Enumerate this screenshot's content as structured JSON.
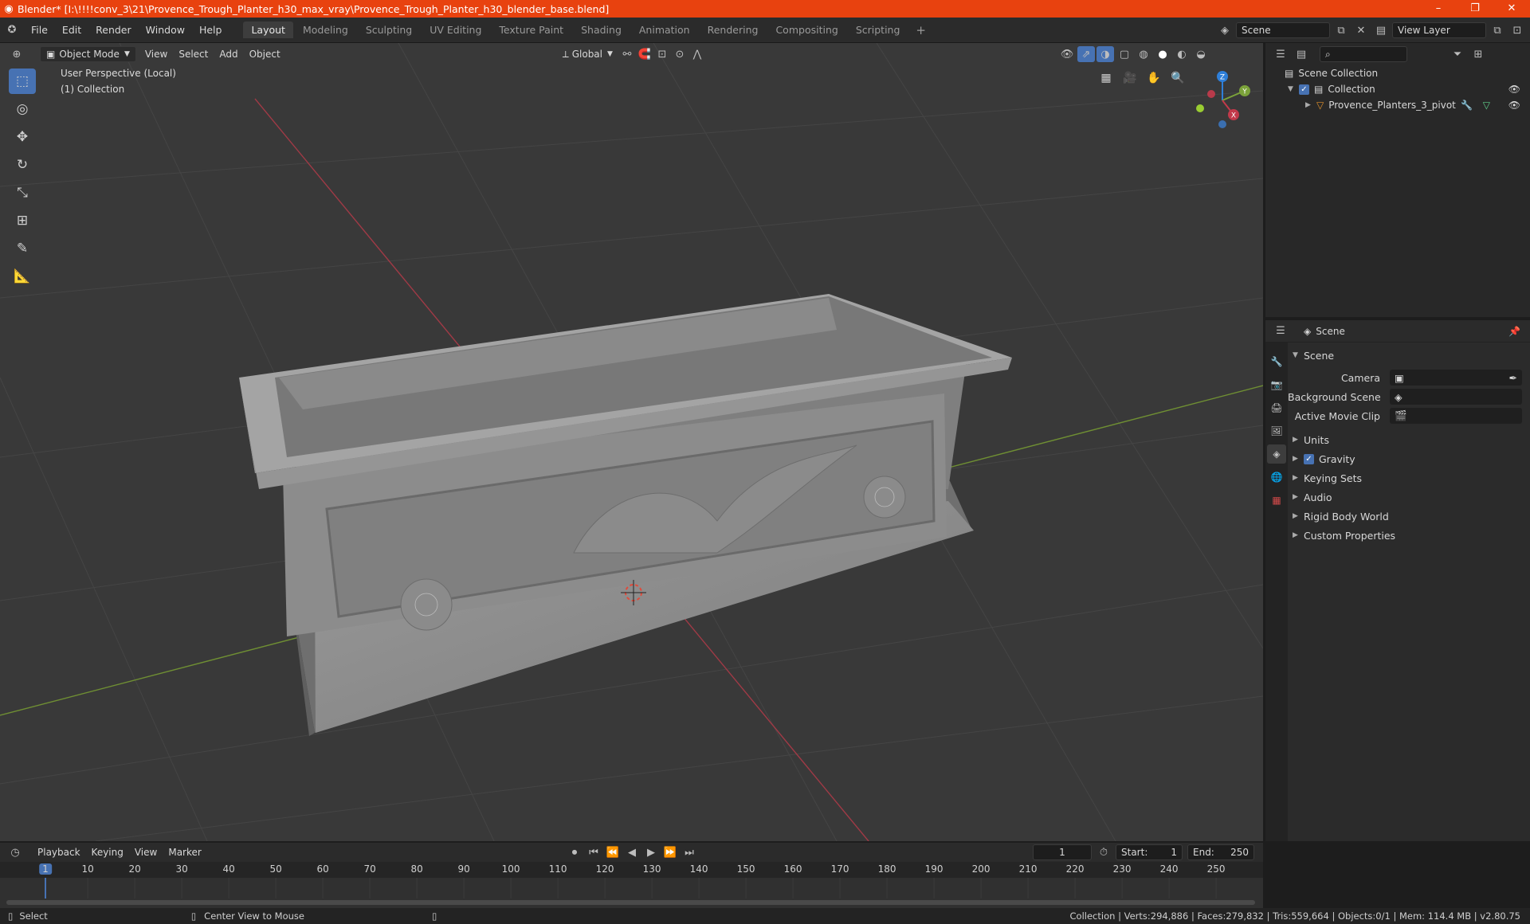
{
  "window": {
    "title": "Blender* [I:\\!!!!conv_3\\21\\Provence_Trough_Planter_h30_max_vray\\Provence_Trough_Planter_h30_blender_base.blend]",
    "controls": [
      "–",
      "❐",
      "✕"
    ]
  },
  "menu": [
    "File",
    "Edit",
    "Render",
    "Window",
    "Help"
  ],
  "workspaces": [
    {
      "label": "Layout",
      "active": true
    },
    {
      "label": "Modeling"
    },
    {
      "label": "Sculpting"
    },
    {
      "label": "UV Editing"
    },
    {
      "label": "Texture Paint"
    },
    {
      "label": "Shading"
    },
    {
      "label": "Animation"
    },
    {
      "label": "Rendering"
    },
    {
      "label": "Compositing"
    },
    {
      "label": "Scripting"
    }
  ],
  "scene_field": "Scene",
  "view_layer_field": "View Layer",
  "viewport_header": {
    "mode": "Object Mode",
    "menus": [
      "View",
      "Select",
      "Add",
      "Object"
    ],
    "transform_orientation": "Global"
  },
  "viewport": {
    "perspective": "User Perspective (Local)",
    "collection": "(1) Collection",
    "axes": {
      "x": "X",
      "y": "Y",
      "z": "Z"
    }
  },
  "outliner": {
    "root": "Scene Collection",
    "collection": "Collection",
    "object": "Provence_Planters_3_pivot"
  },
  "properties": {
    "context": "Scene",
    "section": "Scene",
    "fields": [
      {
        "label": "Camera"
      },
      {
        "label": "Background Scene"
      },
      {
        "label": "Active Movie Clip"
      }
    ],
    "panels": [
      "Units",
      "Gravity",
      "Keying Sets",
      "Audio",
      "Rigid Body World",
      "Custom Properties"
    ]
  },
  "timeline": {
    "menus": [
      "Playback",
      "Keying",
      "View",
      "Marker"
    ],
    "current_frame": "1",
    "start_label": "Start:",
    "start": "1",
    "end_label": "End:",
    "end": "250",
    "ticks": [
      "1",
      "10",
      "20",
      "30",
      "40",
      "50",
      "60",
      "70",
      "80",
      "90",
      "100",
      "110",
      "120",
      "130",
      "140",
      "150",
      "160",
      "170",
      "180",
      "190",
      "200",
      "210",
      "220",
      "230",
      "240",
      "250"
    ]
  },
  "statusbar": {
    "left": "Select",
    "middle": "Center View to Mouse",
    "right": "Collection | Verts:294,886 | Faces:279,832 | Tris:559,664 | Objects:0/1 | Mem: 114.4 MB | v2.80.75"
  },
  "colors": {
    "titlebar": "#e8420f",
    "accent": "#4772b3",
    "viewport_bg": "#393939",
    "x_axis": "#c2394a",
    "y_axis": "#7ba23a",
    "z_axis": "#2e7fd9"
  }
}
